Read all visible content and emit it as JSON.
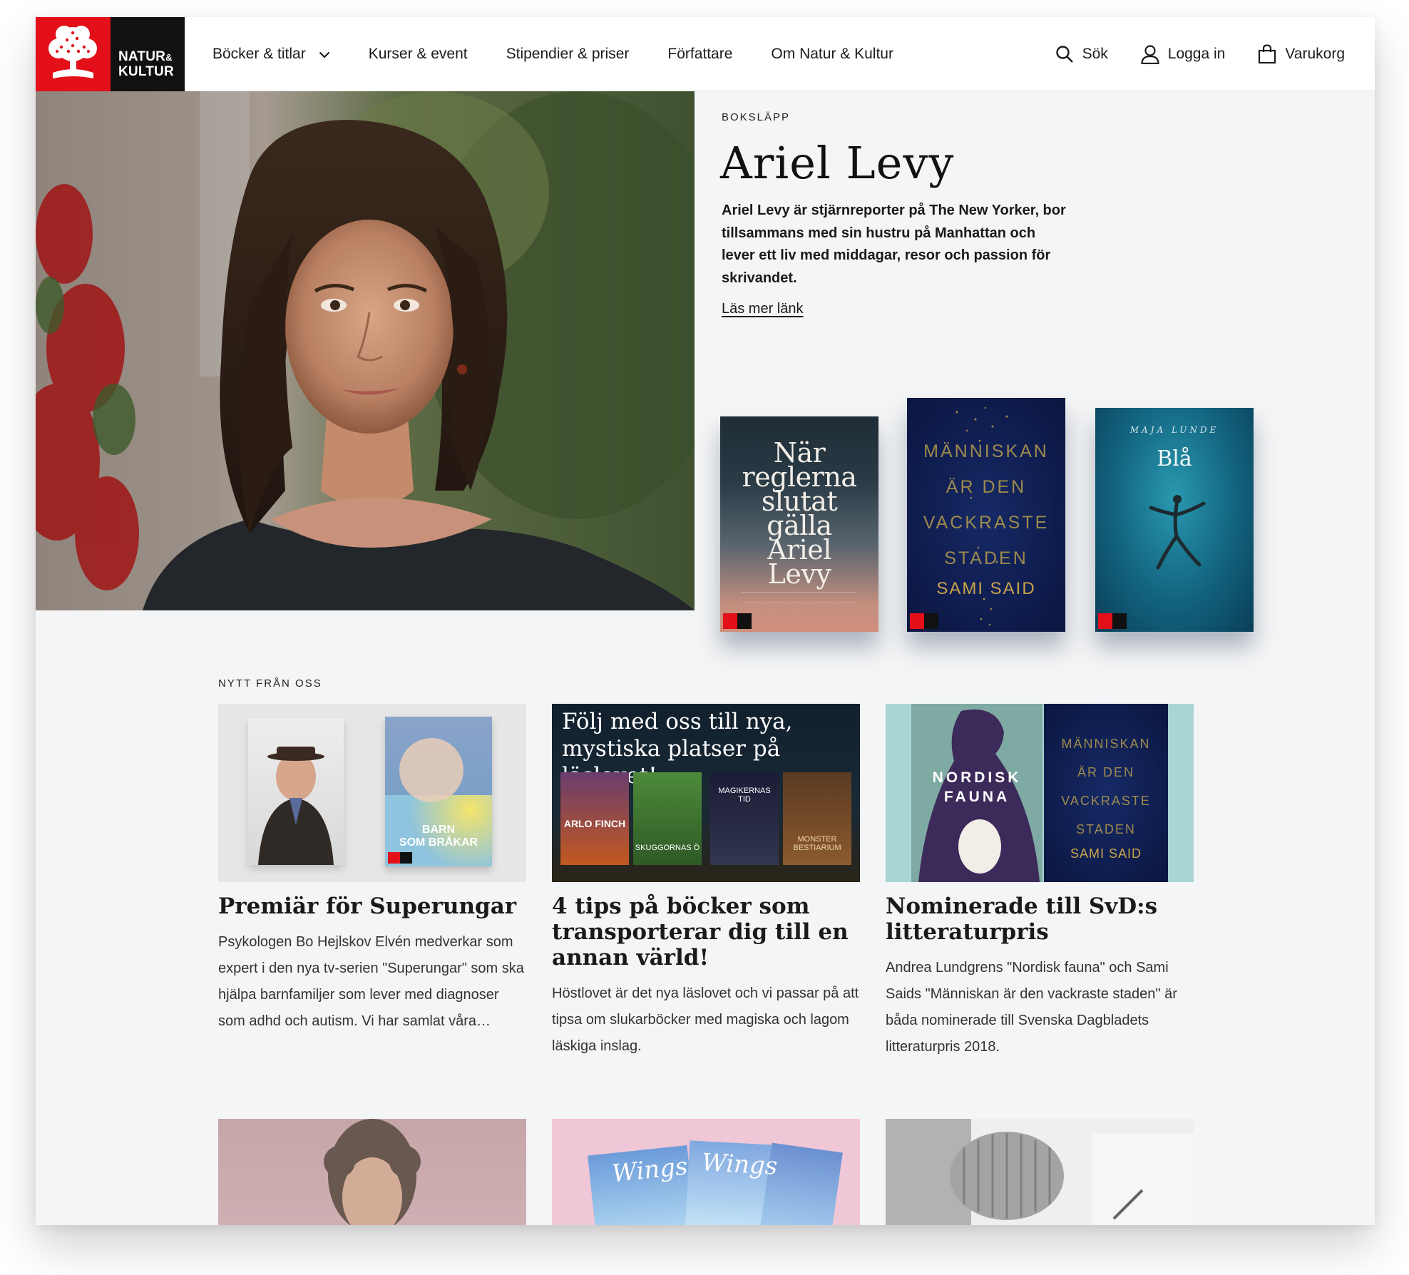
{
  "header": {
    "logo": {
      "line1": "NATUR",
      "amp": "&",
      "line2": "KULTUR"
    },
    "nav": [
      {
        "label": "Böcker & titlar",
        "has_dropdown": true
      },
      {
        "label": "Kurser & event"
      },
      {
        "label": "Stipendier & priser"
      },
      {
        "label": "Författare"
      },
      {
        "label": "Om Natur & Kultur"
      }
    ],
    "tools": {
      "search": "Sök",
      "login": "Logga in",
      "cart": "Varukorg"
    }
  },
  "hero": {
    "eyebrow": "BOKSLÄPP",
    "title": "Ariel Levy",
    "description": "Ariel Levy är stjärnreporter på The New Yorker, bor tillsammans med sin hustru på Manhattan och lever ett liv med middagar, resor och passion för skrivandet.",
    "link": "Läs mer länk",
    "books": [
      {
        "title_lines": [
          "När",
          "reglerna",
          "slutat",
          "gälla",
          "Ariel",
          "Levy"
        ]
      },
      {
        "title_lines": [
          "MÄNNISKAN",
          "ÄR DEN",
          "VACKRASTE",
          "STADEN"
        ],
        "author": "SAMI SAID"
      },
      {
        "author": "MAJA LUNDE",
        "title": "Blå"
      }
    ]
  },
  "news": {
    "eyebrow": "NYTT FRÅN OSS",
    "cards": [
      {
        "title": "Premiär för Superungar",
        "text": "Psykologen Bo Hejlskov Elvén medverkar som expert i den nya tv-serien \"Superungar\" som ska hjälpa barnfamiljer som lever med diagnoser som adhd och autism. Vi har samlat våra…",
        "image_book_title": [
          "BARN",
          "SOM BRÅKAR"
        ]
      },
      {
        "title": "4 tips på böcker som transporterar dig till en annan värld!",
        "text": "Höstlovet är det nya läslovet och vi passar på att tipsa om slukarböcker med magiska och lagom läskiga inslag.",
        "image_headline": [
          "Följ med oss till nya,",
          "mystiska platser på läslovet!"
        ],
        "image_books": [
          "ARLO FINCH",
          "SKUGGORNAS Ö",
          "MAGIKERNAS TID",
          "MONSTER BESTIARIUM"
        ]
      },
      {
        "title": "Nominerade till SvD:s litteraturpris",
        "text": "Andrea Lundgrens \"Nordisk fauna\" och Sami Saids \"Människan är den vackraste staden\" är båda nominerade till Svenska Dagbladets litteraturpris 2018.",
        "image_book1": [
          "NORDISK",
          "FAUNA"
        ],
        "image_book2": [
          "MÄNNISKAN",
          "ÄR DEN",
          "VACKRASTE",
          "STADEN",
          "SAMI SAID"
        ]
      }
    ],
    "more_cards": [
      {
        "image": "author-portrait"
      },
      {
        "image_text": [
          "Wings",
          "Wings"
        ]
      },
      {
        "image": "microphone"
      }
    ]
  },
  "colors": {
    "brand_red": "#e3101a",
    "logo_black": "#111111",
    "page_bg": "#f4f5f6"
  }
}
